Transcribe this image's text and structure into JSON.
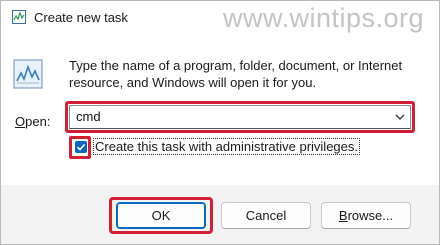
{
  "window": {
    "title": "Create new task",
    "watermark": "www.wintips.org"
  },
  "content": {
    "description": "Type the name of a program, folder, document, or Internet resource, and Windows will open it for you.",
    "open_label_accel": "O",
    "open_label_rest": "pen:",
    "open_value": "cmd",
    "admin_checkbox_label": "Create this task with administrative privileges.",
    "admin_checkbox_checked": true
  },
  "buttons": {
    "ok_label": "OK",
    "cancel_label": "Cancel",
    "browse_accel": "B",
    "browse_rest": "rowse..."
  },
  "colors": {
    "highlight": "#d21f33",
    "accent": "#0a66c2"
  }
}
